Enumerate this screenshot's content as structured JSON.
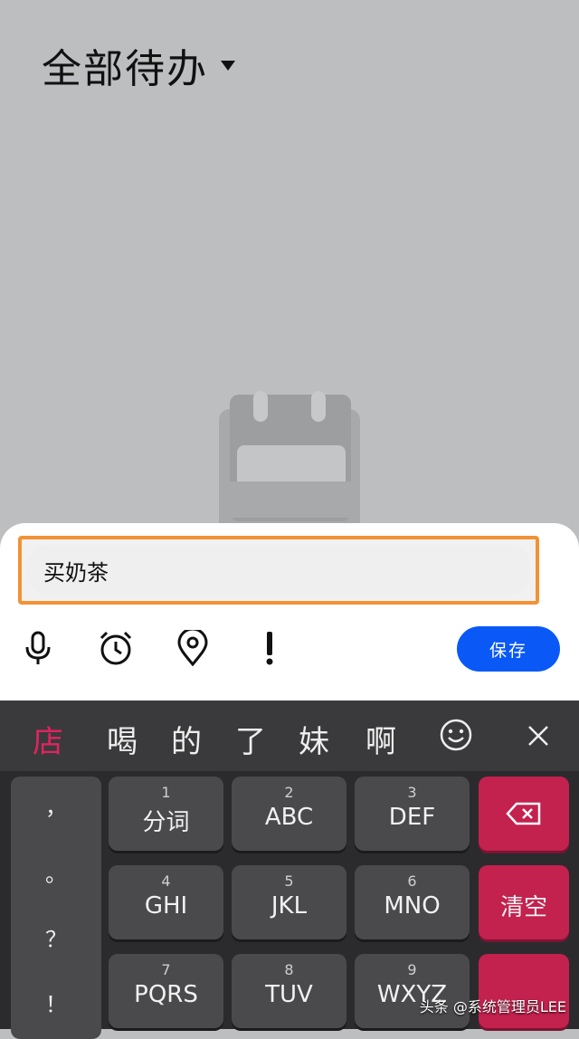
{
  "header": {
    "title": "全部待办"
  },
  "todo_input": {
    "value": "买奶茶"
  },
  "toolbar": {
    "save_label": "保存"
  },
  "ime": {
    "candidates": [
      "店",
      "喝",
      "的",
      "了",
      "妹",
      "啊"
    ],
    "punctuation": [
      "，",
      "。",
      "？",
      "！"
    ],
    "keys": [
      {
        "num": "1",
        "label": "分词"
      },
      {
        "num": "2",
        "label": "ABC"
      },
      {
        "num": "3",
        "label": "DEF"
      },
      {
        "num": "4",
        "label": "GHI"
      },
      {
        "num": "5",
        "label": "JKL"
      },
      {
        "num": "6",
        "label": "MNO"
      },
      {
        "num": "7",
        "label": "PQRS"
      },
      {
        "num": "8",
        "label": "TUV"
      },
      {
        "num": "9",
        "label": "WXYZ"
      }
    ],
    "clear_label": "清空"
  },
  "watermark": "头条 @系统管理员LEE",
  "colors": {
    "accent": "#0a59f7",
    "highlight": "#f39234",
    "keyboard_red": "#c3214e"
  }
}
